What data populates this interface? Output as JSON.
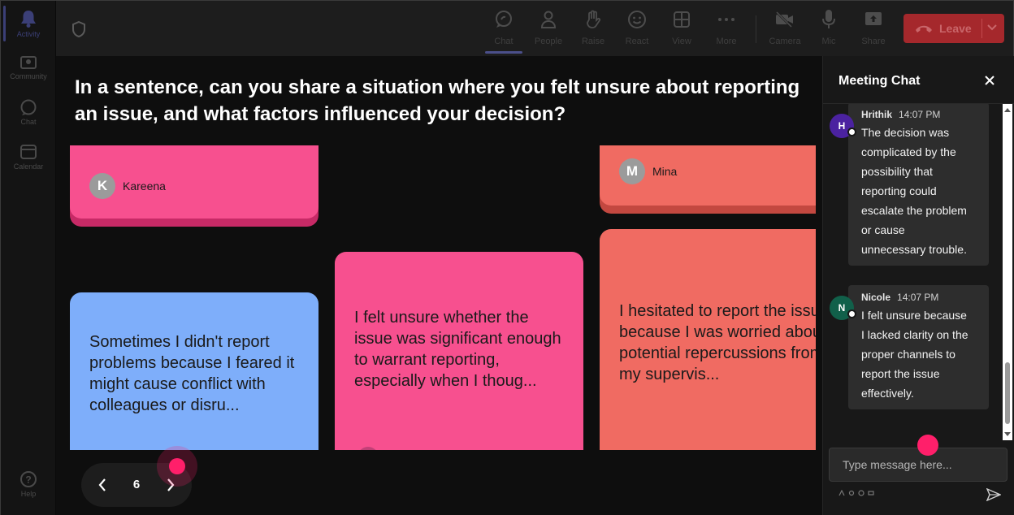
{
  "rail": {
    "items": [
      {
        "label": "Activity",
        "icon": "bell-icon",
        "active": true
      },
      {
        "label": "Community",
        "icon": "community-icon"
      },
      {
        "label": "Chat",
        "icon": "chat-icon"
      },
      {
        "label": "Calendar",
        "icon": "calendar-icon"
      },
      {
        "label": "Help",
        "icon": "help-icon"
      }
    ]
  },
  "toolbar": {
    "buttons": [
      {
        "label": "Chat",
        "icon": "chat-icon",
        "active": true
      },
      {
        "label": "People",
        "icon": "people-icon"
      },
      {
        "label": "Raise",
        "icon": "raise-hand-icon"
      },
      {
        "label": "React",
        "icon": "react-emoji-icon"
      },
      {
        "label": "View",
        "icon": "view-grid-icon"
      },
      {
        "label": "More",
        "icon": "more-icon"
      },
      {
        "label": "Camera",
        "icon": "camera-off-icon"
      },
      {
        "label": "Mic",
        "icon": "mic-icon"
      },
      {
        "label": "Share",
        "icon": "share-icon"
      }
    ],
    "leave_label": "Leave"
  },
  "stage": {
    "question": "In a sentence, can you share a situation where you felt unsure about reporting an issue, and what factors influenced your decision?",
    "cards": [
      {
        "author": "Kareena",
        "initial": "K",
        "color": "#f7508f"
      },
      {
        "author": "Mina",
        "initial": "M",
        "color": "#f06b62"
      },
      {
        "text": [
          "Sometimes I didn't report",
          "problems because I feared it",
          "might cause conflict with",
          "colleagues or disru..."
        ],
        "color": "#7eaefa"
      },
      {
        "text": [
          "I felt unsure whether the",
          "issue was significant enough",
          "to warrant reporting,",
          "especially when I thoug..."
        ],
        "color": "#f7508f"
      },
      {
        "text": [
          "I hesitated to report the issue",
          "because I was worried about",
          "potential repercussions from",
          "my supervis..."
        ],
        "color": "#f06b62"
      }
    ],
    "pager": {
      "page": "6"
    }
  },
  "chat": {
    "title": "Meeting Chat",
    "messages": [
      {
        "initial": "H",
        "name": "Hrithik",
        "time": "14:07 PM",
        "avatar_color": "#4b22a0",
        "lines": [
          "The decision was",
          "complicated by the",
          "possibility that",
          "reporting could",
          "escalate the problem",
          "or cause",
          "unnecessary trouble."
        ]
      },
      {
        "initial": "N",
        "name": "Nicole",
        "time": "14:07 PM",
        "avatar_color": "#11604a",
        "lines": [
          "I felt unsure because",
          "I lacked clarity on the",
          "proper channels to",
          "report the issue",
          "effectively."
        ]
      }
    ],
    "input_placeholder": "Type message here..."
  }
}
